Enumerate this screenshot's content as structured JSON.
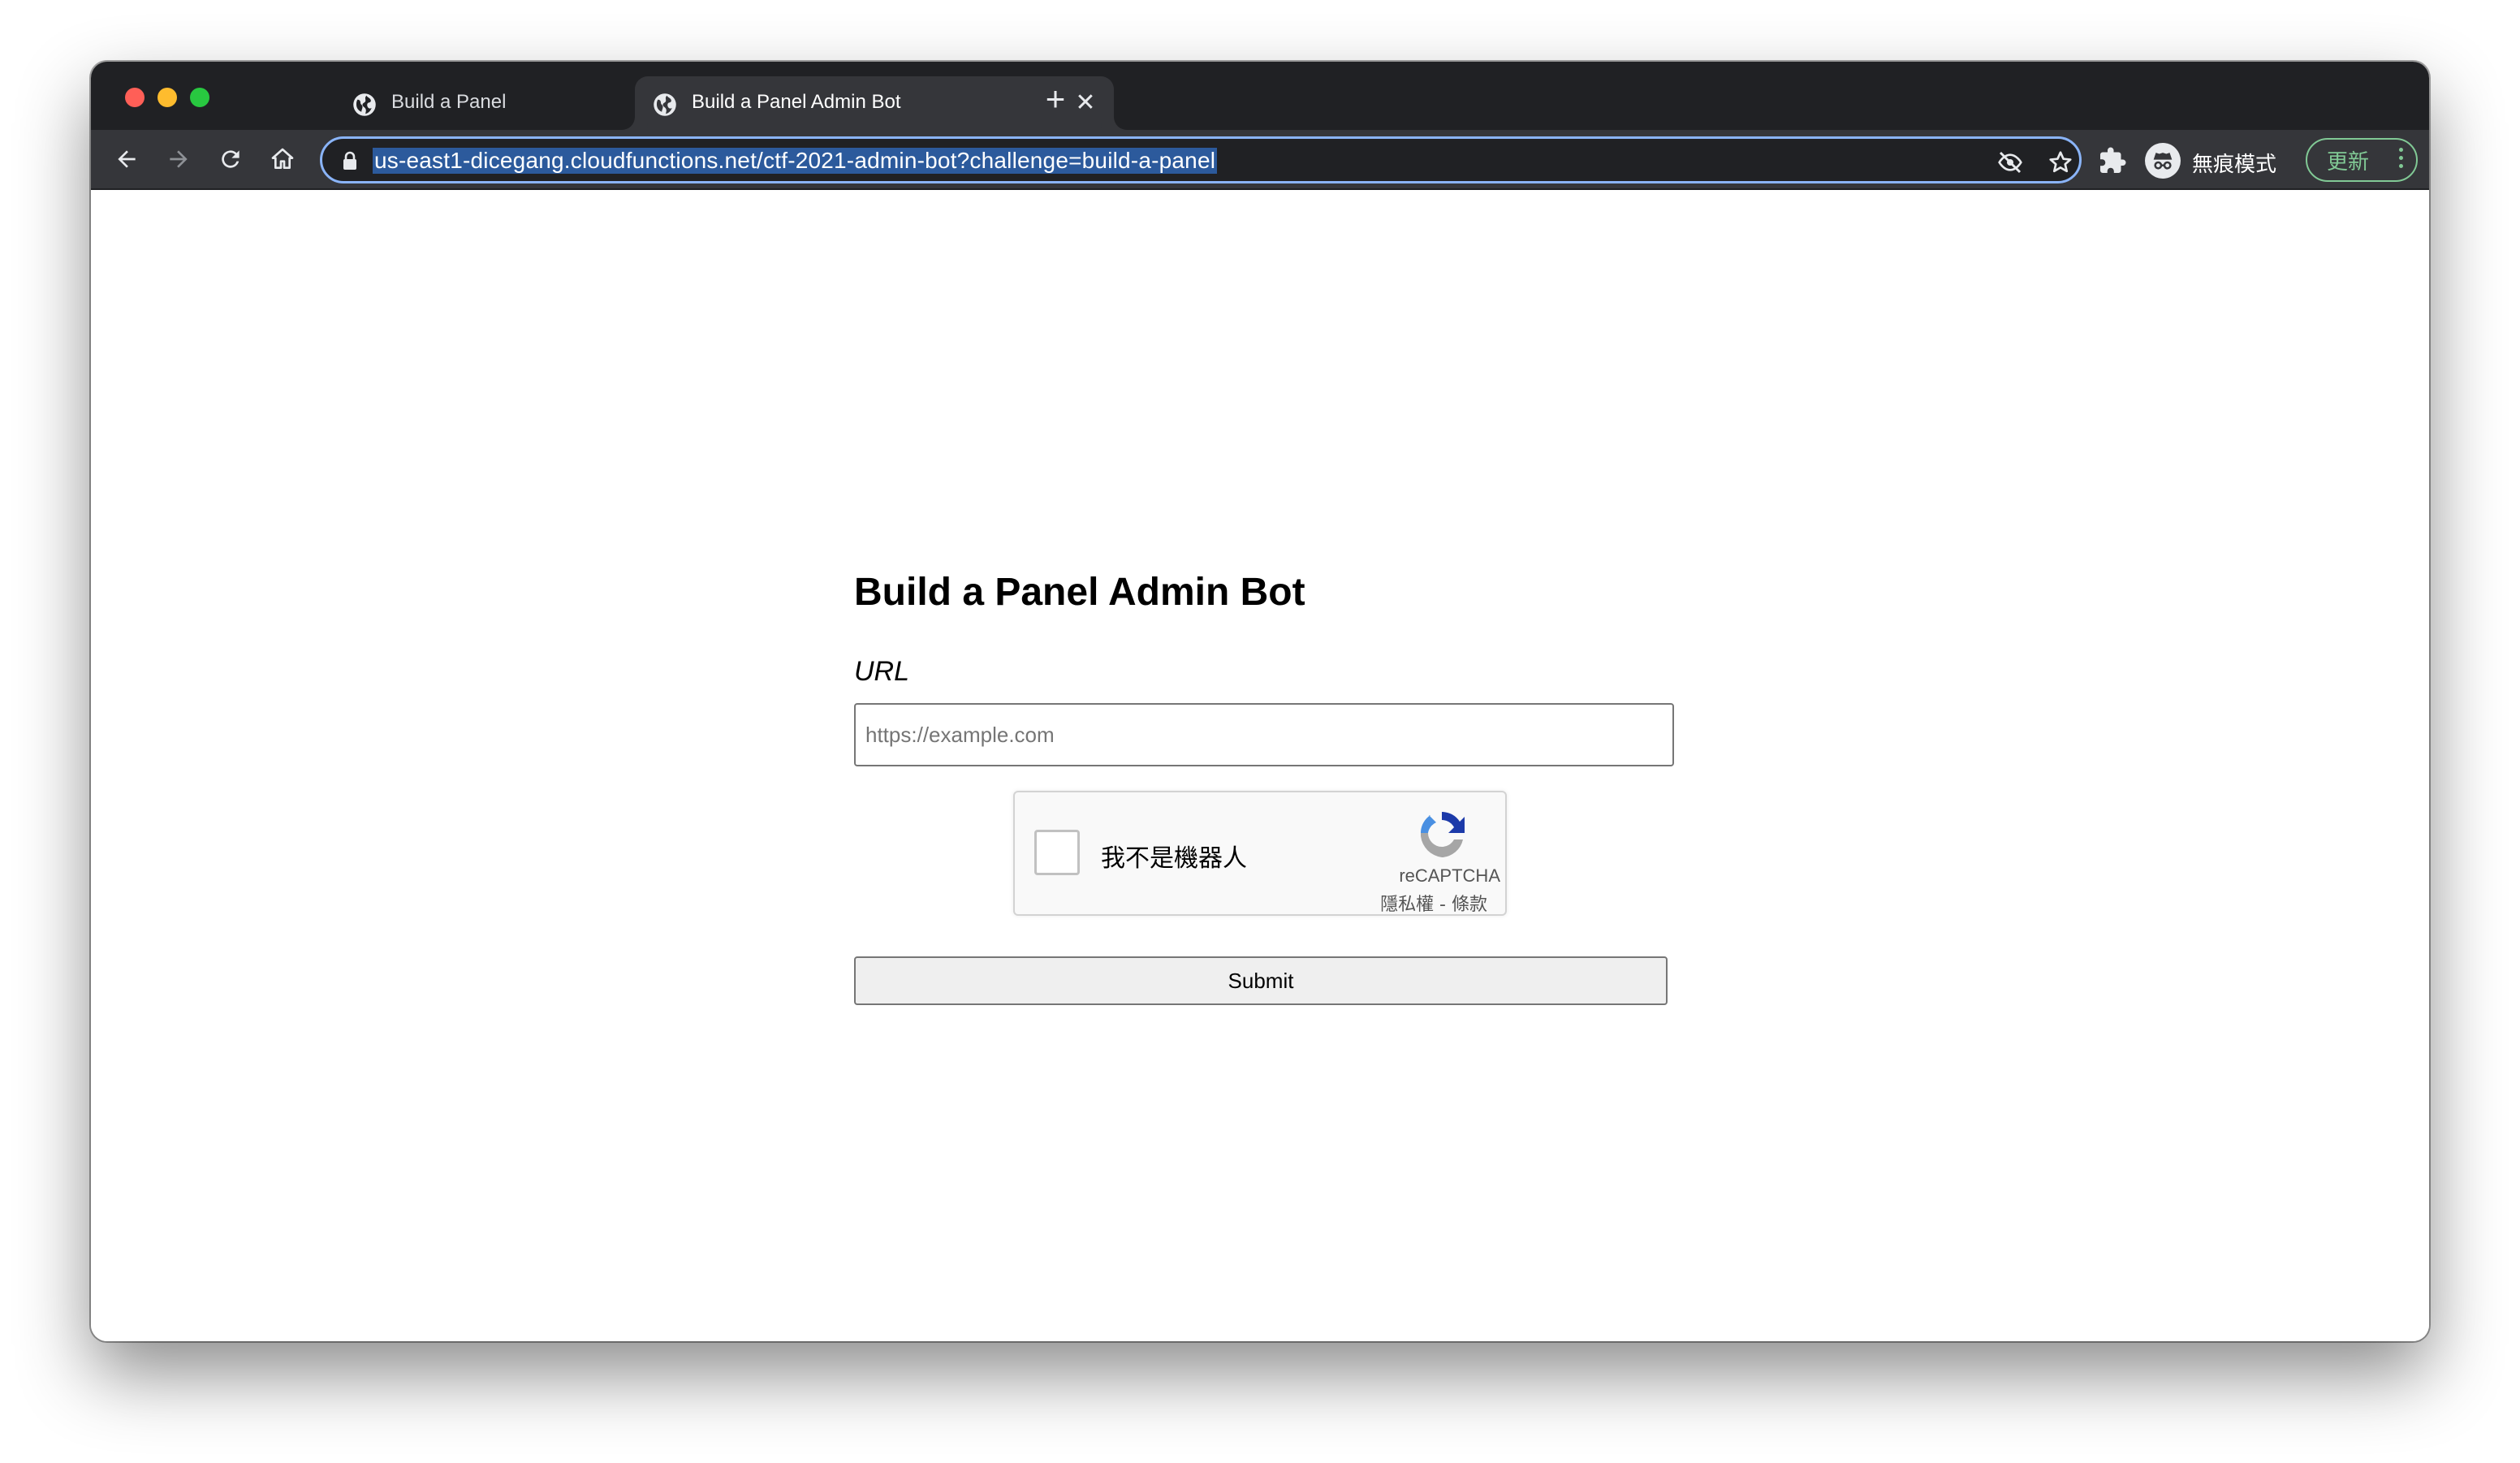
{
  "browser": {
    "tabs": [
      {
        "title": "Build a Panel",
        "active": false
      },
      {
        "title": "Build a Panel Admin Bot",
        "active": true
      }
    ],
    "new_tab_icon": "plus-icon",
    "close_icon": "close-icon",
    "address": "us-east1-dicegang.cloudfunctions.net/ctf-2021-admin-bot?challenge=build-a-panel",
    "incognito_label": "無痕模式",
    "update_label": "更新",
    "accent_color": "#8ab4f8",
    "update_color": "#81c995"
  },
  "page": {
    "title": "Build a Panel Admin Bot",
    "url_label": "URL",
    "url_placeholder": "https://example.com",
    "url_value": "",
    "captcha": {
      "label": "我不是機器人",
      "brand": "reCAPTCHA",
      "links": "隱私權 - 條款",
      "checked": false
    },
    "submit_label": "Submit"
  }
}
